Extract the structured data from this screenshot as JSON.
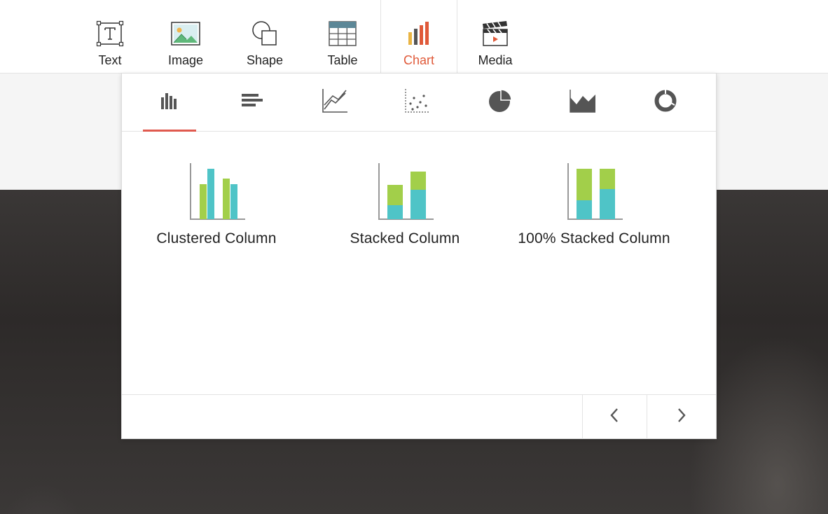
{
  "toolbar": {
    "items": [
      {
        "label": "Text",
        "icon": "text-box-icon"
      },
      {
        "label": "Image",
        "icon": "image-icon"
      },
      {
        "label": "Shape",
        "icon": "shape-icon"
      },
      {
        "label": "Table",
        "icon": "table-icon"
      },
      {
        "label": "Chart",
        "icon": "chart-icon",
        "active": true
      },
      {
        "label": "Media",
        "icon": "clapperboard-icon"
      }
    ],
    "accent_color": "#e05a3a"
  },
  "chart_panel": {
    "tabs": [
      {
        "icon": "column-chart-icon",
        "active": true
      },
      {
        "icon": "bar-chart-icon"
      },
      {
        "icon": "line-chart-icon"
      },
      {
        "icon": "scatter-chart-icon"
      },
      {
        "icon": "pie-chart-icon"
      },
      {
        "icon": "area-chart-icon"
      },
      {
        "icon": "doughnut-chart-icon"
      }
    ],
    "options": [
      {
        "label": "Clustered Column",
        "icon": "clustered-column-icon"
      },
      {
        "label": "Stacked Column",
        "icon": "stacked-column-icon"
      },
      {
        "label": "100% Stacked Column",
        "icon": "percent-stacked-column-icon"
      }
    ],
    "colors": {
      "green": "#a2cf4a",
      "teal": "#4fc4c7",
      "tab_indicator": "#e05a4f"
    },
    "pagination": {
      "prev_icon": "chevron-left-icon",
      "next_icon": "chevron-right-icon"
    }
  }
}
